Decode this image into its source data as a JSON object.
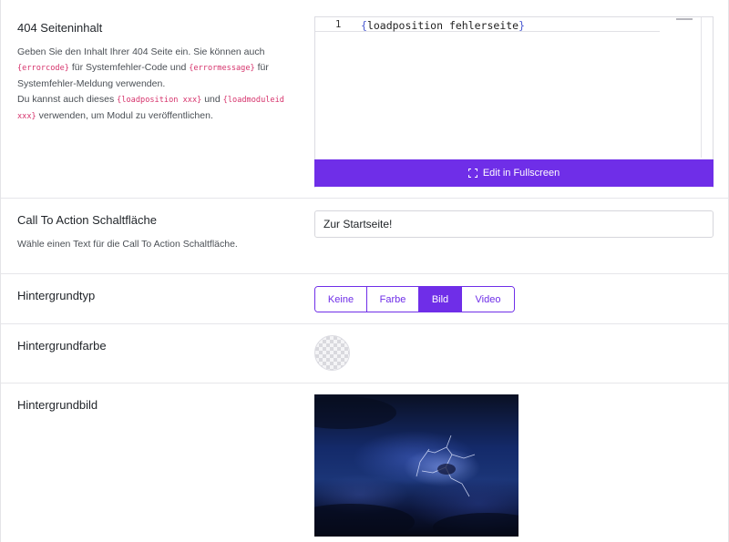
{
  "sections": {
    "page404": {
      "label": "404 Seiteninhalt",
      "desc_1": "Geben Sie den Inhalt Ihrer 404 Seite ein. Sie können auch",
      "code_errorcode": "{errorcode}",
      "desc_2": "für Systemfehler-Code und",
      "code_errormessage": "{errormessage}",
      "desc_3": "für",
      "desc_4": "Systemfehler-Meldung verwenden.",
      "desc_5": "Du kannst auch dieses",
      "code_loadposition": "{loadposition xxx}",
      "desc_6": "und",
      "code_loadmoduleid_a": "{loadmoduleid",
      "code_loadmoduleid_b": "xxx}",
      "desc_7": "verwenden, um Modul zu veröffentlichen.",
      "editor": {
        "line_number": "1",
        "brace_open": "{",
        "code": "loadposition fehlerseite",
        "brace_close": "}"
      },
      "fullscreen_label": "Edit in Fullscreen"
    },
    "cta": {
      "label": "Call To Action Schaltfläche",
      "desc": "Wähle einen Text für die Call To Action Schaltfläche.",
      "value": "Zur Startseite!"
    },
    "bg_type": {
      "label": "Hintergrundtyp",
      "options": [
        "Keine",
        "Farbe",
        "Bild",
        "Video"
      ],
      "selected": "Bild"
    },
    "bg_color": {
      "label": "Hintergrundfarbe"
    },
    "bg_image": {
      "label": "Hintergrundbild"
    }
  },
  "colors": {
    "accent": "#6f2ee8",
    "code_pink": "#d6336c"
  }
}
